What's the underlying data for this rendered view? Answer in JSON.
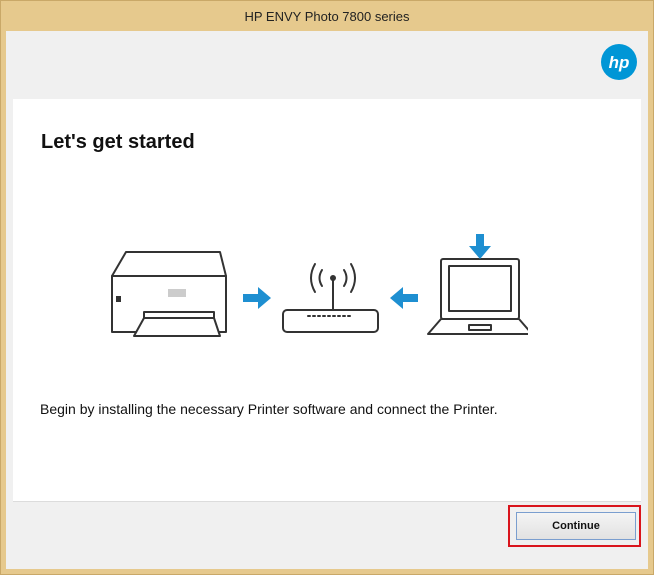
{
  "window": {
    "title": "HP ENVY Photo 7800 series"
  },
  "brand": {
    "logo_text": "hp",
    "color": "#0096d6"
  },
  "page": {
    "heading": "Let's get started",
    "description": "Begin by installing the necessary Printer software and connect the Printer."
  },
  "illustration": {
    "icons": [
      "printer-icon",
      "arrow-right-icon",
      "wifi-router-icon",
      "arrow-left-icon",
      "laptop-icon",
      "arrow-down-icon"
    ],
    "arrow_color": "#1e8fd1"
  },
  "footer": {
    "continue_label": "Continue"
  },
  "highlight_color": "#d9141c"
}
